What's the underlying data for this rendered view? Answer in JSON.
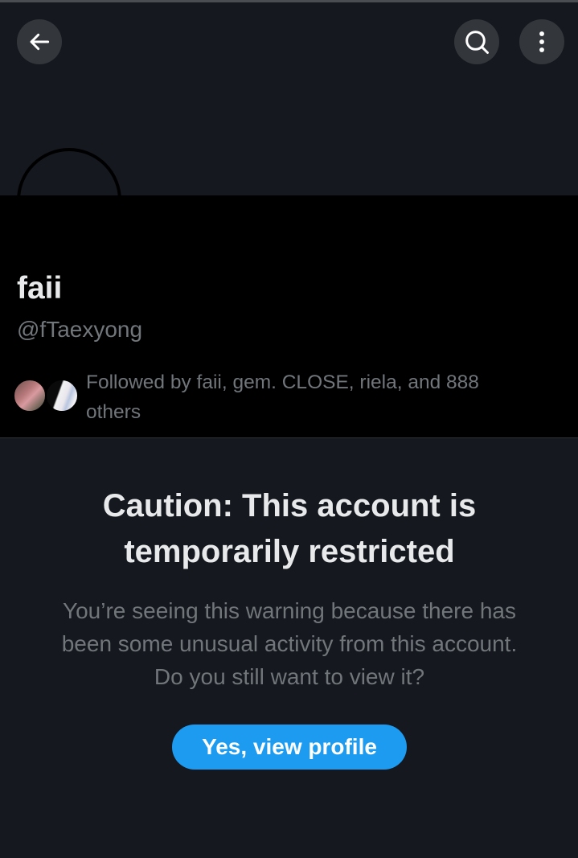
{
  "profile": {
    "display_name": "faii",
    "handle": "@fTaexyong",
    "followed_by_text": "Followed by faii, gem. CLOSE, riela, and 888 others"
  },
  "header": {
    "back_icon": "arrow-left-icon",
    "search_icon": "search-icon",
    "more_icon": "more-vertical-icon"
  },
  "caution": {
    "title": "Caution: This account is temporarily restricted",
    "body": "You’re seeing this warning because there has been some unusual activity from this account. Do you still want to view it?",
    "button_label": "Yes, view profile"
  },
  "colors": {
    "background": "#15181e",
    "panel": "#000000",
    "accent": "#1d9bf0",
    "secondary_text": "#71767b",
    "primary_text": "#e7e9ea"
  }
}
